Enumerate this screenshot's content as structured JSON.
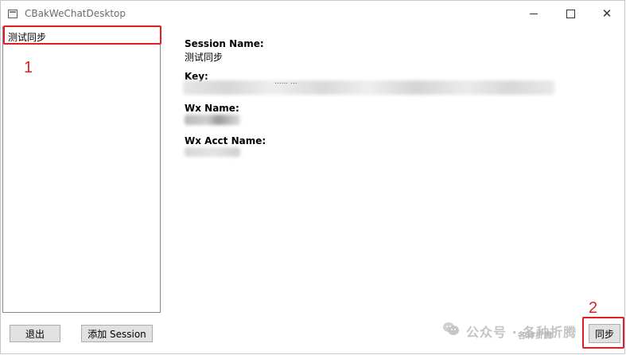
{
  "window": {
    "title": "CBakWeChatDesktop",
    "controls": {
      "minimize": "minimize",
      "maximize": "maximize",
      "close": "✕"
    }
  },
  "sessions": {
    "items": [
      {
        "label": "测试同步"
      }
    ]
  },
  "details": {
    "session_name_label": "Session Name:",
    "session_name_value": "测试同步",
    "key_label": "Key:",
    "key_value_visible": "......  ...",
    "wx_name_label": "Wx Name:",
    "wx_acct_name_label": "Wx Acct Name:"
  },
  "buttons": {
    "exit": "退出",
    "add_session": "添加 Session",
    "sync": "同步"
  },
  "annotations": {
    "marker_1": "1",
    "marker_2": "2",
    "color": "#e02020"
  },
  "watermark": {
    "text": "公众号 · 各种折腾",
    "small_text": "各种折腾"
  }
}
